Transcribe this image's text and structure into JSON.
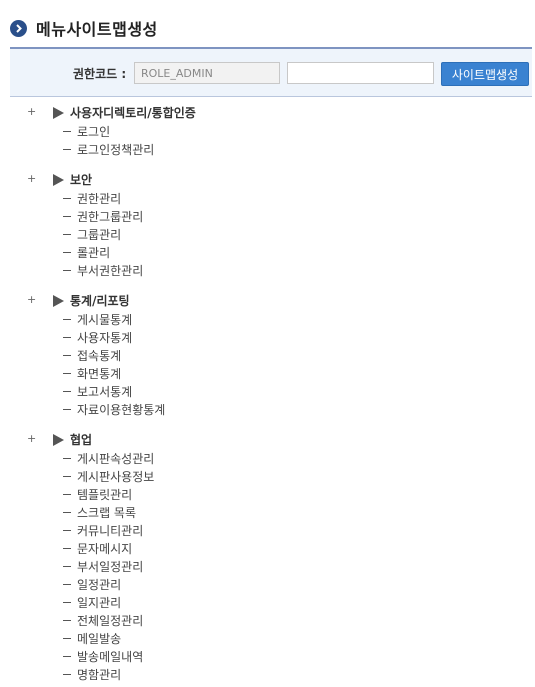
{
  "header": {
    "title": "메뉴사이트맵생성",
    "icon": "chevron-right-icon"
  },
  "search": {
    "label": "권한코드 :",
    "role_code_value": "ROLE_ADMIN",
    "second_value": "",
    "button_label": "사이트맵생성"
  },
  "tree": [
    {
      "toggle": "+",
      "title": "사용자디렉토리/통합인증",
      "children": [
        "로그인",
        "로그인정책관리"
      ]
    },
    {
      "toggle": "+",
      "title": "보안",
      "children": [
        "권한관리",
        "권한그룹관리",
        "그룹관리",
        "롤관리",
        "부서권한관리"
      ]
    },
    {
      "toggle": "+",
      "title": "통계/리포팅",
      "children": [
        "게시물통계",
        "사용자통계",
        "접속통계",
        "화면통계",
        "보고서통계",
        "자료이용현황통계"
      ]
    },
    {
      "toggle": "+",
      "title": "협업",
      "children": [
        "게시판속성관리",
        "게시판사용정보",
        "템플릿관리",
        "스크랩 목록",
        "커뮤니티관리",
        "문자메시지",
        "부서일정관리",
        "일정관리",
        "일지관리",
        "전체일정관리",
        "메일발송",
        "발송메일내역",
        "명함관리"
      ]
    }
  ],
  "colors": {
    "accent": "#3a82d1",
    "title_icon": "#2a4f8a",
    "search_bg": "#eef4fb"
  }
}
